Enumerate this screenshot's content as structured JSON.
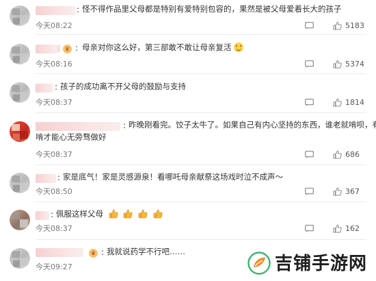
{
  "comments": [
    {
      "text": "怪不得作品里父母都是特别有爱特别包容的，果然是被父母爱着长大的孩子",
      "time": "今天08:22",
      "likes": "5183"
    },
    {
      "text": "母亲对你这么好，第三部敢不敢让母亲复活",
      "time": "今天08:16",
      "likes": "5374"
    },
    {
      "text": "孩子的成功离不开父母的鼓励与支持",
      "time": "今天08:37",
      "likes": "1814"
    },
    {
      "text_line1": "昨晚刚看完。饺子太牛了。如果自己有内心坚持的东西，谁老就啃呗，有的",
      "text_line2": "啃才能心无旁骛做好",
      "time": "今天08:37",
      "likes": "686"
    },
    {
      "text": "家是底气！家是灵感源泉！看哪吒母亲献祭这场戏时泣不成声～",
      "time": "今天08:50",
      "likes": "367"
    },
    {
      "text": "佩服这样父母",
      "time": "今天08:37",
      "likes": "162"
    },
    {
      "text": "我就说药学不行吧……",
      "time": "今天09:27",
      "likes": ""
    }
  ],
  "watermark": {
    "text": "吉铺手游网"
  },
  "colors": {
    "like_icon": "#888888",
    "time_text": "#777777",
    "logo_green": "#3cb371",
    "logo_orange": "#f28c28"
  }
}
